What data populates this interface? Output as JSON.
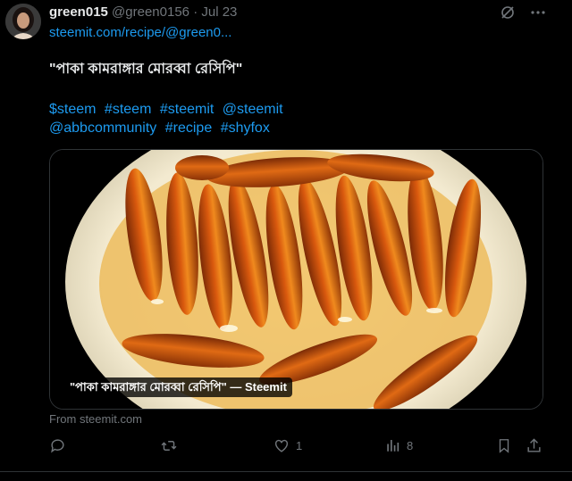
{
  "user": {
    "display_name": "green015",
    "handle": "@green0156",
    "separator": "·",
    "date": "Jul 23"
  },
  "post": {
    "link_text": "steemit.com/recipe/@green0...",
    "title": "\"পাকা কামরাঙ্গার মোরব্বা রেসিপি\"",
    "tags_line1": [
      "$steem",
      "#steem",
      "#steemit",
      "@steemit"
    ],
    "tags_line2": [
      "@abbcommunity",
      "#recipe",
      "#shyfox"
    ]
  },
  "card": {
    "caption": "\"পাকা কামরাঙ্গার মোরব্বা রেসিপি\" — Steemit",
    "source": "From steemit.com"
  },
  "actions": {
    "reply_count": "",
    "repost_count": "",
    "like_count": "1",
    "views_count": "8"
  },
  "icons": {
    "top": [
      "grok-icon",
      "more-icon"
    ],
    "bottom": [
      "reply-icon",
      "repost-icon",
      "like-icon",
      "views-icon",
      "bookmark-icon",
      "share-icon"
    ]
  },
  "colors": {
    "link": "#1d9bf0",
    "muted": "#71767b",
    "text": "#e7e9ea",
    "background": "#000000"
  }
}
